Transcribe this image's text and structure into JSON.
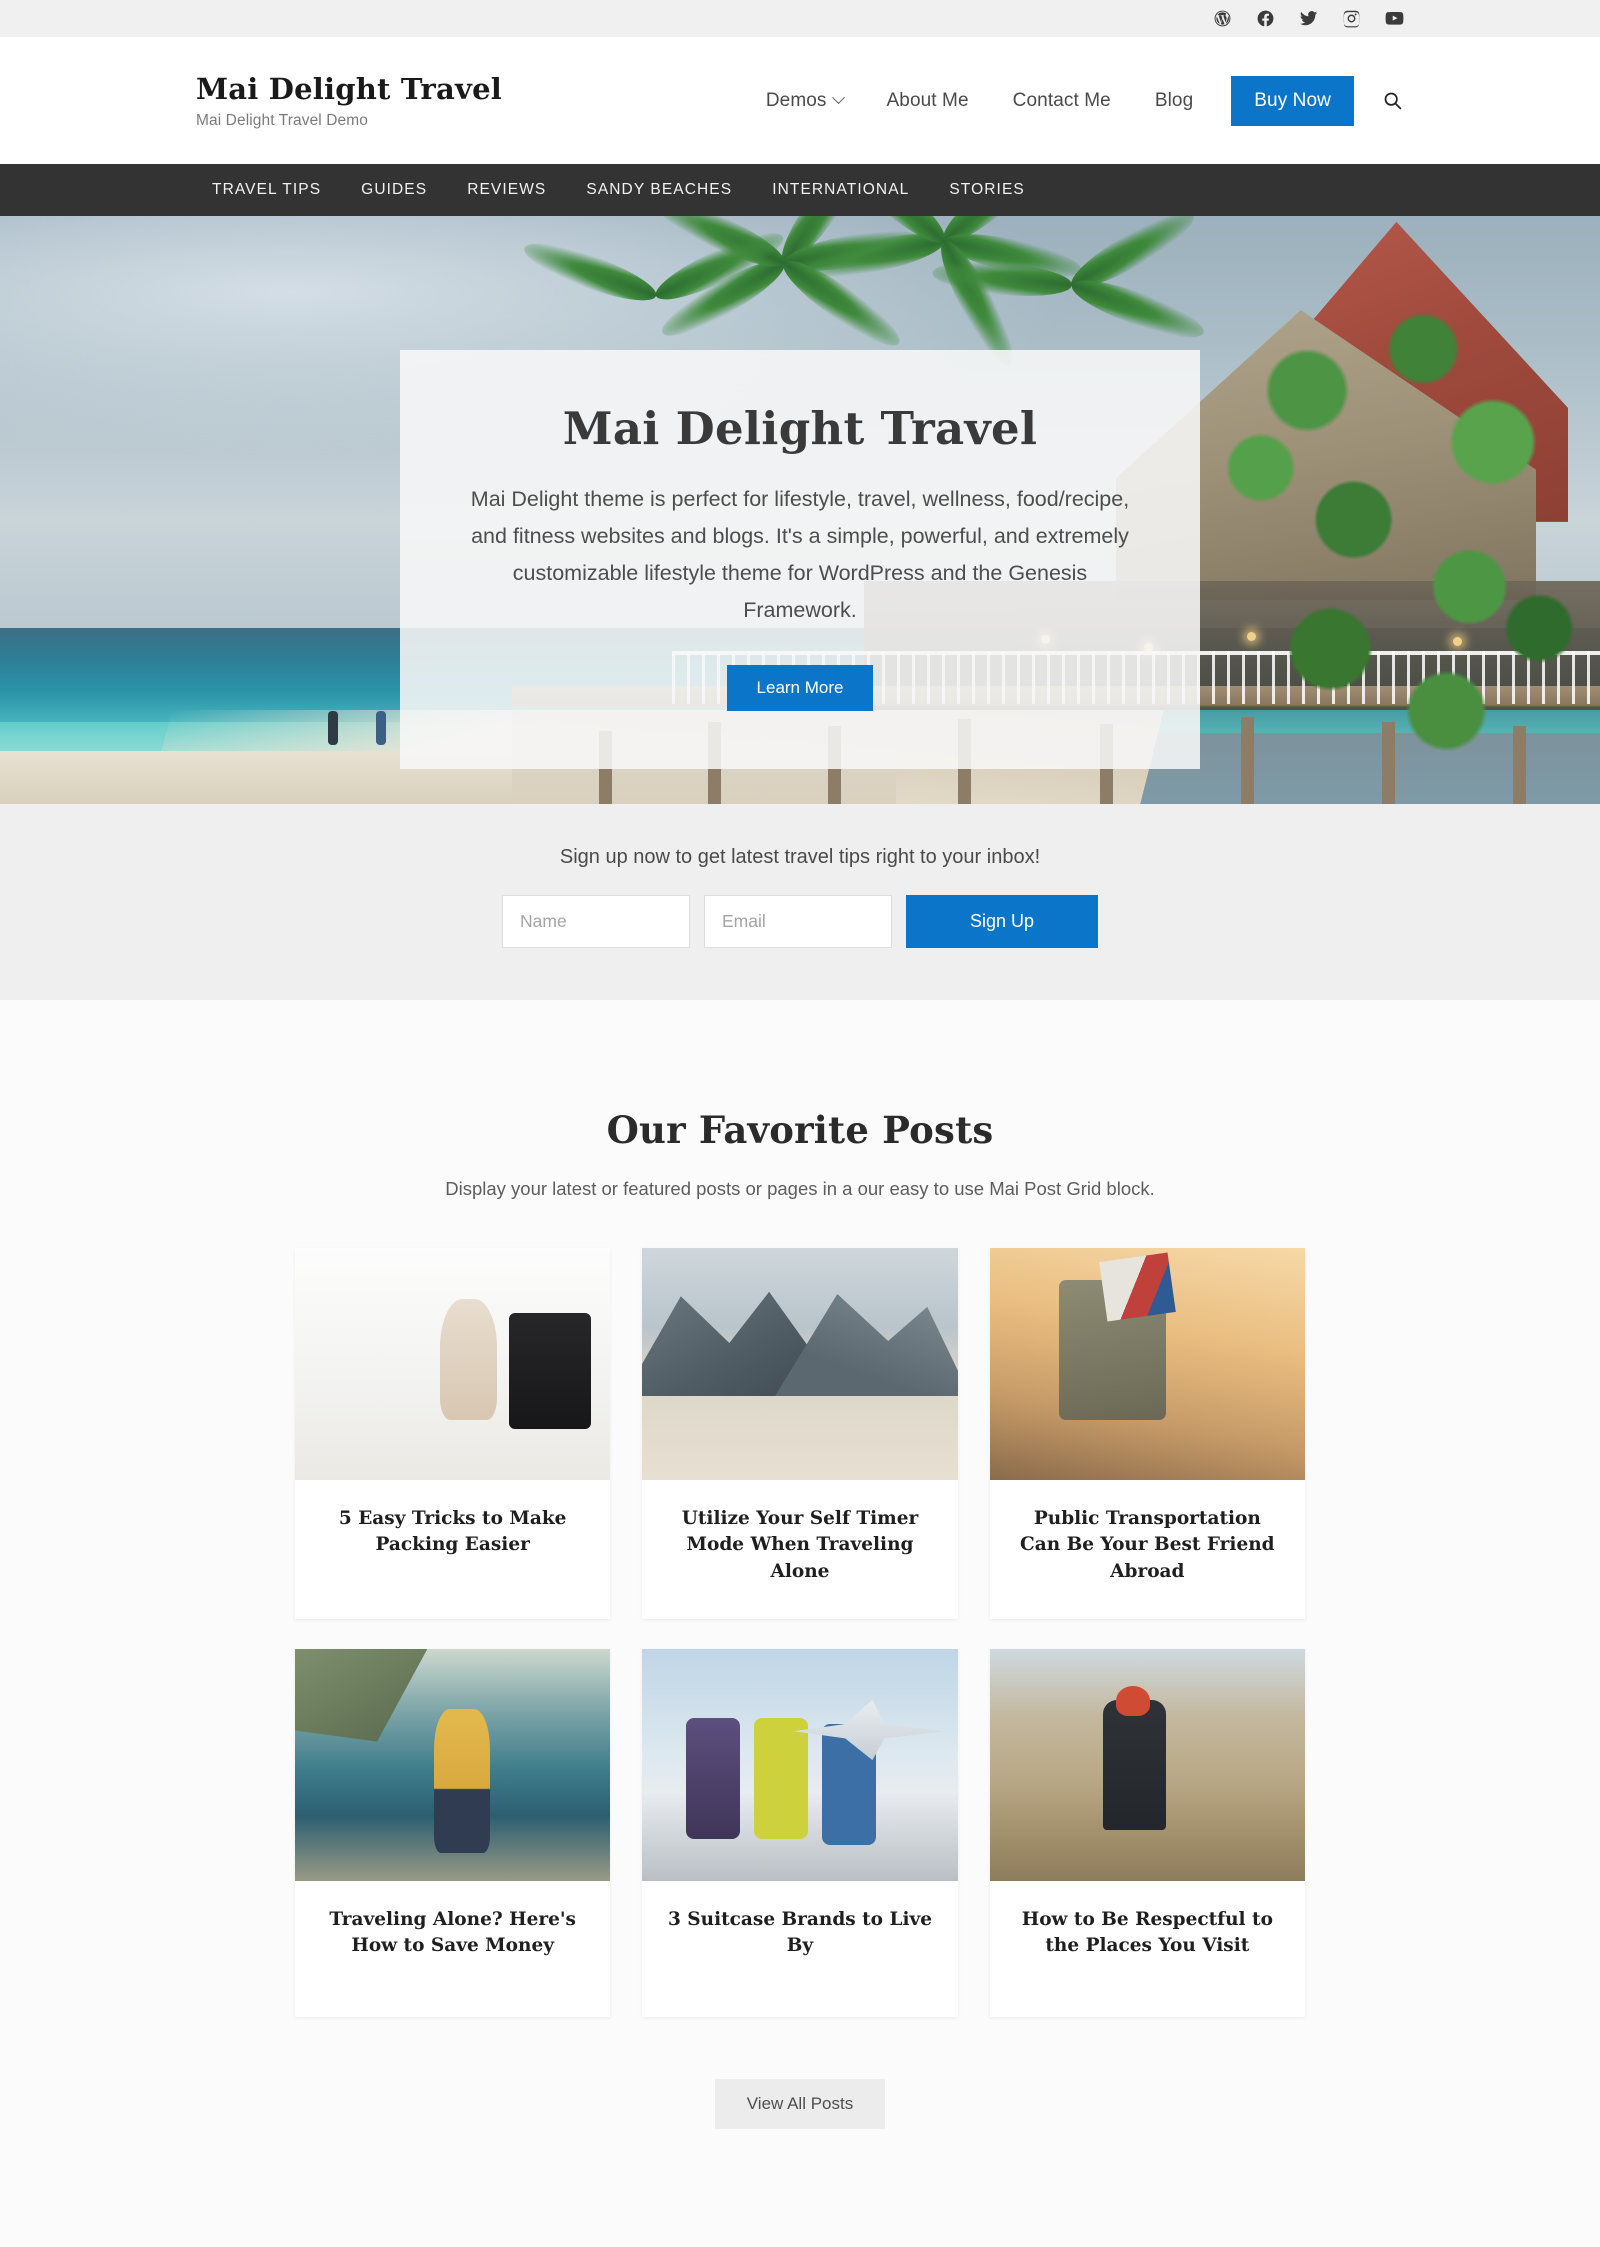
{
  "topbar": {
    "social": [
      {
        "name": "wordpress-icon",
        "label": "WordPress"
      },
      {
        "name": "facebook-icon",
        "label": "Facebook"
      },
      {
        "name": "twitter-icon",
        "label": "Twitter"
      },
      {
        "name": "instagram-icon",
        "label": "Instagram"
      },
      {
        "name": "youtube-icon",
        "label": "YouTube"
      }
    ]
  },
  "header": {
    "site_title": "Mai Delight Travel",
    "tagline": "Mai Delight Travel Demo",
    "nav": [
      {
        "label": "Demos",
        "has_dropdown": true
      },
      {
        "label": "About Me",
        "has_dropdown": false
      },
      {
        "label": "Contact Me",
        "has_dropdown": false
      },
      {
        "label": "Blog",
        "has_dropdown": false
      }
    ],
    "buy_now_label": "Buy Now",
    "search_icon": "search-icon"
  },
  "subnav": {
    "items": [
      {
        "label": "TRAVEL TIPS"
      },
      {
        "label": "GUIDES"
      },
      {
        "label": "REVIEWS"
      },
      {
        "label": "SANDY BEACHES"
      },
      {
        "label": "INTERNATIONAL"
      },
      {
        "label": "STORIES"
      }
    ]
  },
  "hero": {
    "title": "Mai Delight Travel",
    "description": "Mai Delight theme is perfect for lifestyle, travel, wellness, food/recipe, and fitness websites and blogs. It's a simple, powerful, and extremely customizable lifestyle theme for WordPress and the Genesis Framework.",
    "button_label": "Learn More"
  },
  "signup": {
    "heading": "Sign up now to get latest travel tips right to your inbox!",
    "name_placeholder": "Name",
    "name_value": "",
    "email_placeholder": "Email",
    "email_value": "",
    "button_label": "Sign Up"
  },
  "posts": {
    "title": "Our Favorite Posts",
    "subtitle": "Display your latest or featured posts or pages in a our easy to use Mai Post Grid block.",
    "cards": [
      {
        "title": "5 Easy Tricks to Make Packing Easier",
        "image": "woman-packing-suitcase"
      },
      {
        "title": "Utilize Your Self Timer Mode When Traveling Alone",
        "image": "hiker-in-mountain-valley"
      },
      {
        "title": "Public Transportation Can Be Your Best Friend Abroad",
        "image": "backpack-and-luggage-at-sunset"
      },
      {
        "title": "Traveling Alone? Here's How to Save Money",
        "image": "woman-with-yellow-backpack-by-sea"
      },
      {
        "title": "3 Suitcase Brands to Live By",
        "image": "suitcases-at-airport-window"
      },
      {
        "title": "How to Be Respectful to the Places You Visit",
        "image": "woman-sitting-on-hillside"
      }
    ],
    "view_all_label": "View All Posts"
  },
  "colors": {
    "accent": "#0b76c9",
    "subnav_bg": "#333333",
    "topbar_bg": "#f0f0f0",
    "signup_bg": "#efefef",
    "page_bg": "#fbfbfb"
  }
}
